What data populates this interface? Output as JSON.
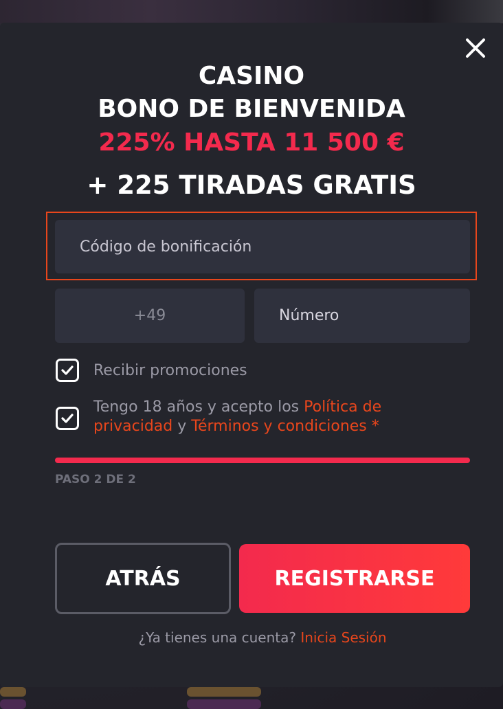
{
  "header": {
    "line1": "CASINO",
    "line2": "BONO DE BIENVENIDA",
    "line3": "225% HASTA 11 500 €",
    "line4": "+ 225 TIRADAS GRATIS"
  },
  "form": {
    "promo_placeholder": "Código de bonificación",
    "country_code": "+49",
    "number_placeholder": "Número"
  },
  "checkboxes": {
    "promotions": {
      "label": "Recibir promociones",
      "checked": true
    },
    "terms": {
      "prefix": "Tengo 18 años y acepto los ",
      "privacy_link": "Política de privacidad",
      "connector": " y ",
      "terms_link": "Términos y condiciones",
      "required_mark": " *",
      "checked": true
    }
  },
  "progress": {
    "step_label": "PASO 2 DE 2",
    "fraction": 1.0
  },
  "buttons": {
    "back": "ATRÁS",
    "register": "REGISTRARSE"
  },
  "footer": {
    "question": "¿Ya tienes una cuenta? ",
    "login_link": "Inicia Sesión"
  },
  "icons": {
    "close": "close-icon",
    "check": "check-icon"
  },
  "colors": {
    "accent_red": "#f32a4d",
    "link_orange": "#e8461c",
    "modal_bg": "#24252c",
    "field_bg": "#2f313d"
  }
}
